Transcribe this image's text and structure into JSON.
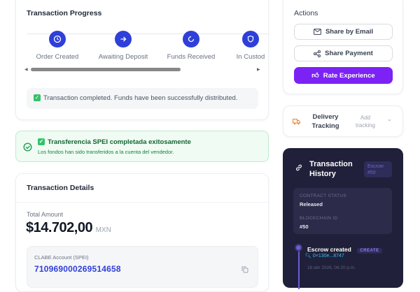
{
  "progress": {
    "title": "Transaction Progress",
    "steps": [
      {
        "label": "Order Created",
        "icon": "clock-icon"
      },
      {
        "label": "Awaiting Deposit",
        "icon": "arrow-right-icon"
      },
      {
        "label": "Funds Received",
        "icon": "refresh-icon"
      },
      {
        "label": "In Custod",
        "icon": "shield-icon"
      }
    ],
    "notice": "Transaction completed. Funds have been successfully distributed."
  },
  "spei": {
    "title": "Transferencia SPEI completada exitosamente",
    "subtitle": "Los fondos han sido transferidos a la cuenta del vendedor."
  },
  "details": {
    "title": "Transaction Details",
    "total_label": "Total Amount",
    "amount": "$14.702,00",
    "currency": "MXN",
    "clabe_label": "CLABE Account (SPEI)",
    "clabe": "710969000269514658"
  },
  "actions": {
    "title": "Actions",
    "share_email": "Share by Email",
    "share_payment": "Share Payment",
    "rate": "Rate Experience"
  },
  "delivery": {
    "title": "Delivery Tracking",
    "add": "Add tracking"
  },
  "history": {
    "title": "Transaction History",
    "badge": "Escrow #50",
    "status_label": "CONTRACT STATUS",
    "status": "Released",
    "chain_label": "BLOCKCHAIN ID",
    "chain_id": "#50",
    "event": {
      "title": "Escrow created",
      "tag": "CREATE",
      "hash": "0×130e...8747",
      "time": "18 abr 2026, 06:20 p.m."
    }
  },
  "colors": {
    "primary": "#2f3fd9",
    "accent": "#7c22f5",
    "success": "#34c26a",
    "dark": "#20203a"
  }
}
